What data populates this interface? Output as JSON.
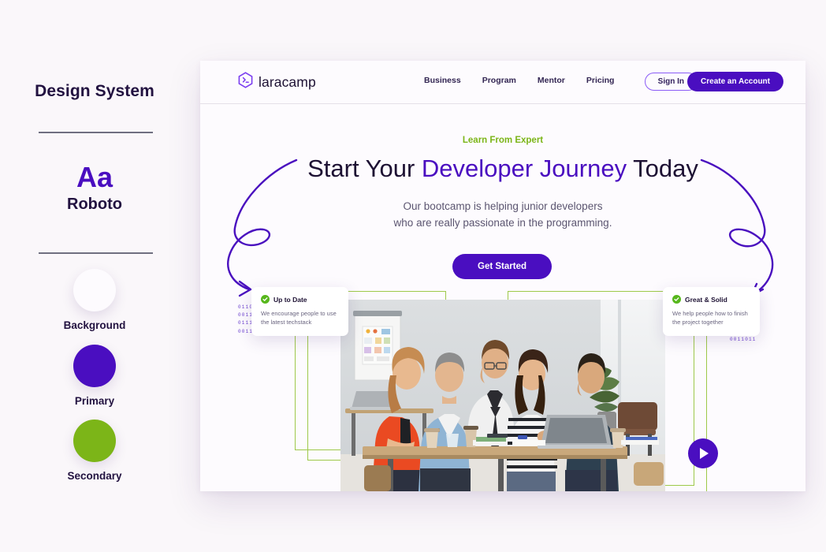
{
  "design_system": {
    "title": "Design System",
    "type_sample": "Aa",
    "font_name": "Roboto",
    "swatches": [
      {
        "label": "Background",
        "color": "#fdfbfe"
      },
      {
        "label": "Primary",
        "color": "#4a0ec0"
      },
      {
        "label": "Secondary",
        "color": "#7cb518"
      }
    ]
  },
  "site": {
    "navbar": {
      "logo_icon": "hexagon-terminal-icon",
      "brand": "laracamp",
      "links": [
        "Business",
        "Program",
        "Mentor",
        "Pricing"
      ],
      "sign_in_label": "Sign In",
      "create_account_label": "Create an Account"
    },
    "hero": {
      "eyebrow": "Learn From Expert",
      "heading_before": "Start Your ",
      "heading_highlight": "Developer Journey",
      "heading_after": " Today",
      "subtitle_line1": "Our bootcamp is helping junior developers",
      "subtitle_line2": "who are really passionate in the programming.",
      "cta_label": "Get Started"
    },
    "media": {
      "play_icon": "play-triangle-icon",
      "photo_alt": "team of five people collaborating around a table with laptops"
    },
    "feature_cards": [
      {
        "icon": "check-circle-icon",
        "title": "Up to Date",
        "body": "We encourage people to use the latest techstack"
      },
      {
        "icon": "check-circle-icon",
        "title": "Great & Solid",
        "body": "We help people how to finish the project together"
      }
    ],
    "decorations": {
      "binary_left": "0110\n0011\n0111010\n0011011",
      "binary_right": "1010\n1010\n0111010\n0011011",
      "curve_left_icon": "squiggly-arrow-right-icon",
      "curve_right_icon": "squiggly-arrow-down-left-icon"
    }
  },
  "colors": {
    "canvas": "#faf7fa",
    "primary": "#4a0ec0",
    "secondary": "#7cb518",
    "highlight": "#c3e85c",
    "text_dark": "#1d1133",
    "text_muted": "#5b5570"
  }
}
